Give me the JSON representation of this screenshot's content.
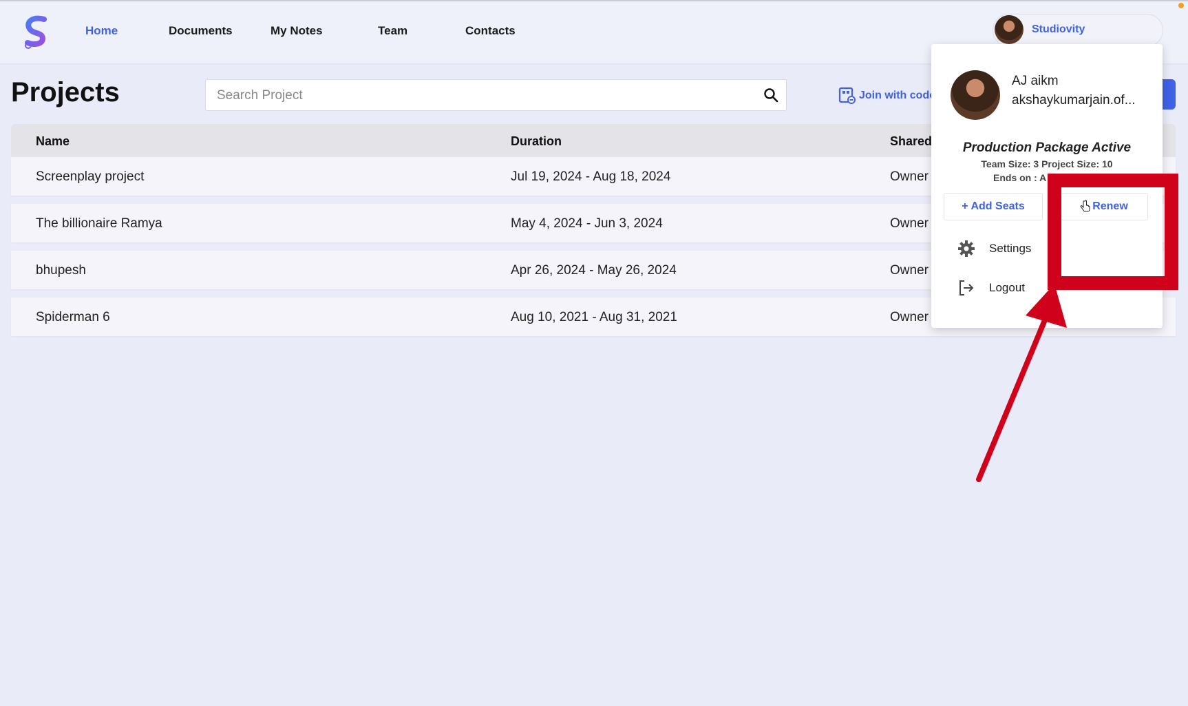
{
  "nav": {
    "logo_label": "S",
    "links": [
      {
        "label": "Home",
        "active": true
      },
      {
        "label": "Documents",
        "active": false
      },
      {
        "label": "My Notes",
        "active": false
      },
      {
        "label": "Team",
        "active": false
      },
      {
        "label": "Contacts",
        "active": false
      }
    ],
    "profile_name": "Studiovity"
  },
  "page": {
    "title": "Projects",
    "search_placeholder": "Search Project",
    "join_label": "Join with code"
  },
  "table": {
    "headers": [
      "Name",
      "Duration",
      "Shared"
    ],
    "rows": [
      {
        "name": "Screenplay project",
        "duration": "Jul 19, 2024 - Aug 18, 2024",
        "shared": "Owner"
      },
      {
        "name": "The billionaire Ramya",
        "duration": "May 4, 2024 - Jun 3, 2024",
        "shared": "Owner"
      },
      {
        "name": "bhupesh",
        "duration": "Apr 26, 2024 - May 26, 2024",
        "shared": "Owner"
      },
      {
        "name": "Spiderman 6",
        "duration": "Aug 10, 2021 - Aug 31, 2021",
        "shared": "Owner"
      }
    ]
  },
  "dropdown": {
    "user_name": "AJ aikm",
    "user_email": "akshaykumarjain.of...",
    "package_title": "Production Package Active",
    "package_sizes": "Team Size: 3  Project Size: 10",
    "ends_on": "Ends on : A",
    "add_seats_label": "+ Add Seats",
    "renew_label": "Renew",
    "settings_label": "Settings",
    "logout_label": "Logout"
  },
  "colors": {
    "accent": "#3f62e6",
    "annotation_red": "#d0021b",
    "background": "#eaebf8"
  }
}
